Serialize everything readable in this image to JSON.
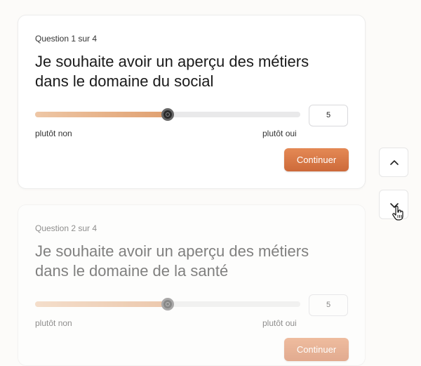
{
  "questions": [
    {
      "number_label": "Question 1 sur 4",
      "title": "Je souhaite avoir un aperçu des métiers dans le domaine du social",
      "slider_value": 5,
      "slider_max": 10,
      "value_text": "5",
      "low_label": "plutôt non",
      "high_label": "plutôt oui",
      "continue_label": "Continuer"
    },
    {
      "number_label": "Question 2 sur 4",
      "title": "Je souhaite avoir un aperçu des métiers dans le domaine de la santé",
      "slider_value": 5,
      "slider_max": 10,
      "value_text": "5",
      "low_label": "plutôt non",
      "high_label": "plutôt oui",
      "continue_label": "Continuer"
    }
  ],
  "nav": {
    "up_icon": "chevron-up-icon",
    "down_icon": "chevron-down-icon"
  },
  "colors": {
    "accent": "#d9733f",
    "slider_fill": "#e6a879",
    "background": "#fcfbf9"
  }
}
